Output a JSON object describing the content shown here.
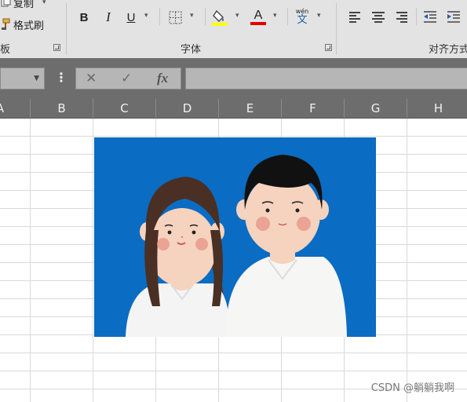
{
  "ribbon": {
    "clipboard": {
      "copy_label": "复制",
      "format_painter_label": "格式刷",
      "group_label": "板"
    },
    "font": {
      "bold_label": "B",
      "italic_label": "I",
      "underline_label": "U",
      "font_color_label": "A",
      "phonetic_top": "wén",
      "phonetic_bottom": "文",
      "group_label": "字体",
      "fill_color": "#ffff00",
      "font_color": "#e00000"
    },
    "alignment": {
      "group_label": "对齐方式"
    }
  },
  "formula_bar": {
    "cancel_label": "✕",
    "enter_label": "✓",
    "fx_label": "fx",
    "value": ""
  },
  "columns": [
    "A",
    "B",
    "C",
    "D",
    "E",
    "F",
    "G",
    "H"
  ],
  "picture": {
    "background_color": "#0a6cc2",
    "subjects": [
      "woman-avatar",
      "man-avatar"
    ]
  },
  "watermark": "CSDN @躺躺我啊"
}
